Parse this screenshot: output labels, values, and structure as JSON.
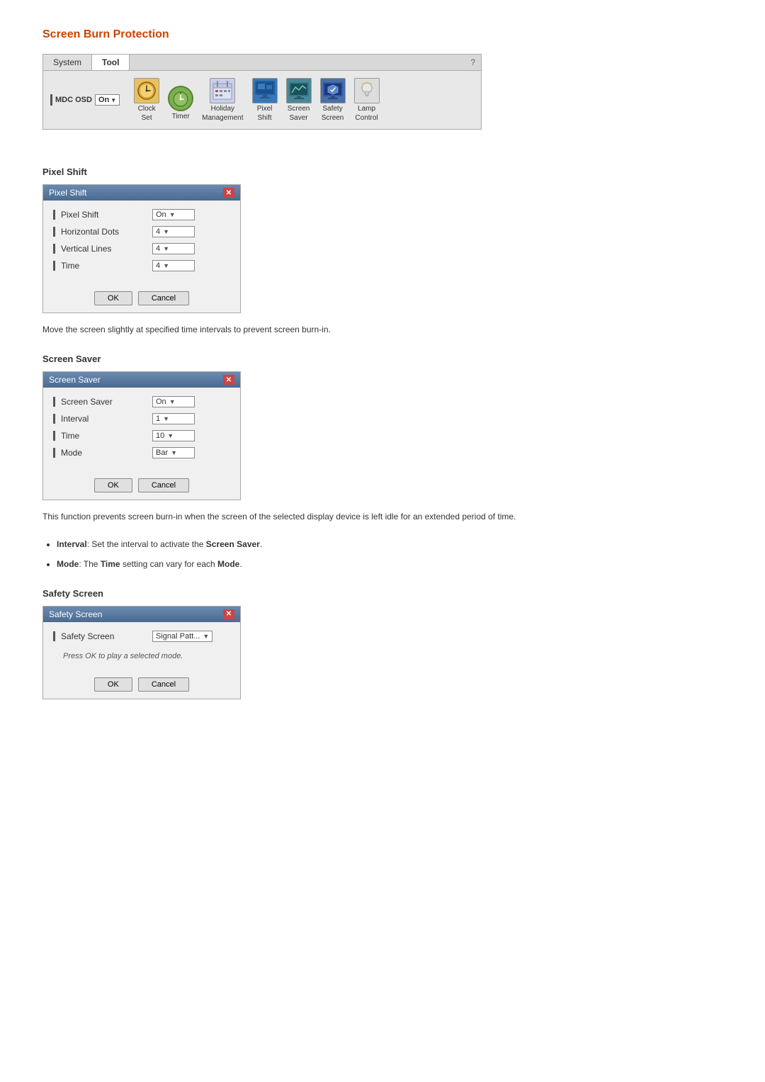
{
  "page": {
    "main_title": "Screen Burn Protection"
  },
  "toolbar": {
    "tabs": [
      {
        "label": "System",
        "active": false
      },
      {
        "label": "Tool",
        "active": true
      }
    ],
    "help_label": "?",
    "mdc_osd_label": "MDC OSD",
    "mdc_osd_value": "On",
    "items": [
      {
        "label": "Clock\nSet",
        "label_line1": "Clock",
        "label_line2": "Set",
        "icon_type": "clock"
      },
      {
        "label": "Timer",
        "label_line1": "Timer",
        "label_line2": "",
        "icon_type": "timer"
      },
      {
        "label": "Holiday\nManagement",
        "label_line1": "Holiday",
        "label_line2": "Management",
        "icon_type": "holiday"
      },
      {
        "label": "Pixel\nShift",
        "label_line1": "Pixel",
        "label_line2": "Shift",
        "icon_type": "pixel"
      },
      {
        "label": "Screen\nSaver",
        "label_line1": "Screen",
        "label_line2": "Saver",
        "icon_type": "screensaver"
      },
      {
        "label": "Safety\nScreen",
        "label_line1": "Safety",
        "label_line2": "Screen",
        "icon_type": "safety"
      },
      {
        "label": "Lamp\nControl",
        "label_line1": "Lamp",
        "label_line2": "Control",
        "icon_type": "lamp"
      }
    ]
  },
  "pixel_shift_section": {
    "section_title": "Pixel Shift",
    "dialog_title": "Pixel Shift",
    "rows": [
      {
        "label": "Pixel Shift",
        "value": "On",
        "has_arrow": true
      },
      {
        "label": "Horizontal Dots",
        "value": "4",
        "has_arrow": true
      },
      {
        "label": "Vertical Lines",
        "value": "4",
        "has_arrow": true
      },
      {
        "label": "Time",
        "value": "4",
        "has_arrow": true
      }
    ],
    "ok_label": "OK",
    "cancel_label": "Cancel",
    "description": "Move the screen slightly at specified time intervals to prevent screen burn-in."
  },
  "screen_saver_section": {
    "section_title": "Screen Saver",
    "dialog_title": "Screen Saver",
    "rows": [
      {
        "label": "Screen Saver",
        "value": "On",
        "has_arrow": true
      },
      {
        "label": "Interval",
        "value": "1",
        "has_arrow": true
      },
      {
        "label": "Time",
        "value": "10",
        "has_arrow": true
      },
      {
        "label": "Mode",
        "value": "Bar",
        "has_arrow": true
      }
    ],
    "ok_label": "OK",
    "cancel_label": "Cancel",
    "description": "This function prevents screen burn-in when the screen of the selected display device is left idle for an extended period of time.",
    "bullets": [
      {
        "key": "Interval",
        "text": ": Set the interval to activate the ",
        "bold_after": "Screen Saver",
        "rest": "."
      },
      {
        "key": "Mode",
        "text": ": The ",
        "bold_mid": "Time",
        "text2": " setting can vary for each ",
        "bold_end": "Mode",
        "rest": "."
      }
    ]
  },
  "safety_screen_section": {
    "section_title": "Safety Screen",
    "dialog_title": "Safety Screen",
    "rows": [
      {
        "label": "Safety Screen",
        "value": "Signal Patt...",
        "has_arrow": true
      }
    ],
    "note": "Press OK to play a selected mode.",
    "ok_label": "OK",
    "cancel_label": "Cancel"
  },
  "icons": {
    "close": "✕",
    "dropdown_arrow": "▼"
  }
}
